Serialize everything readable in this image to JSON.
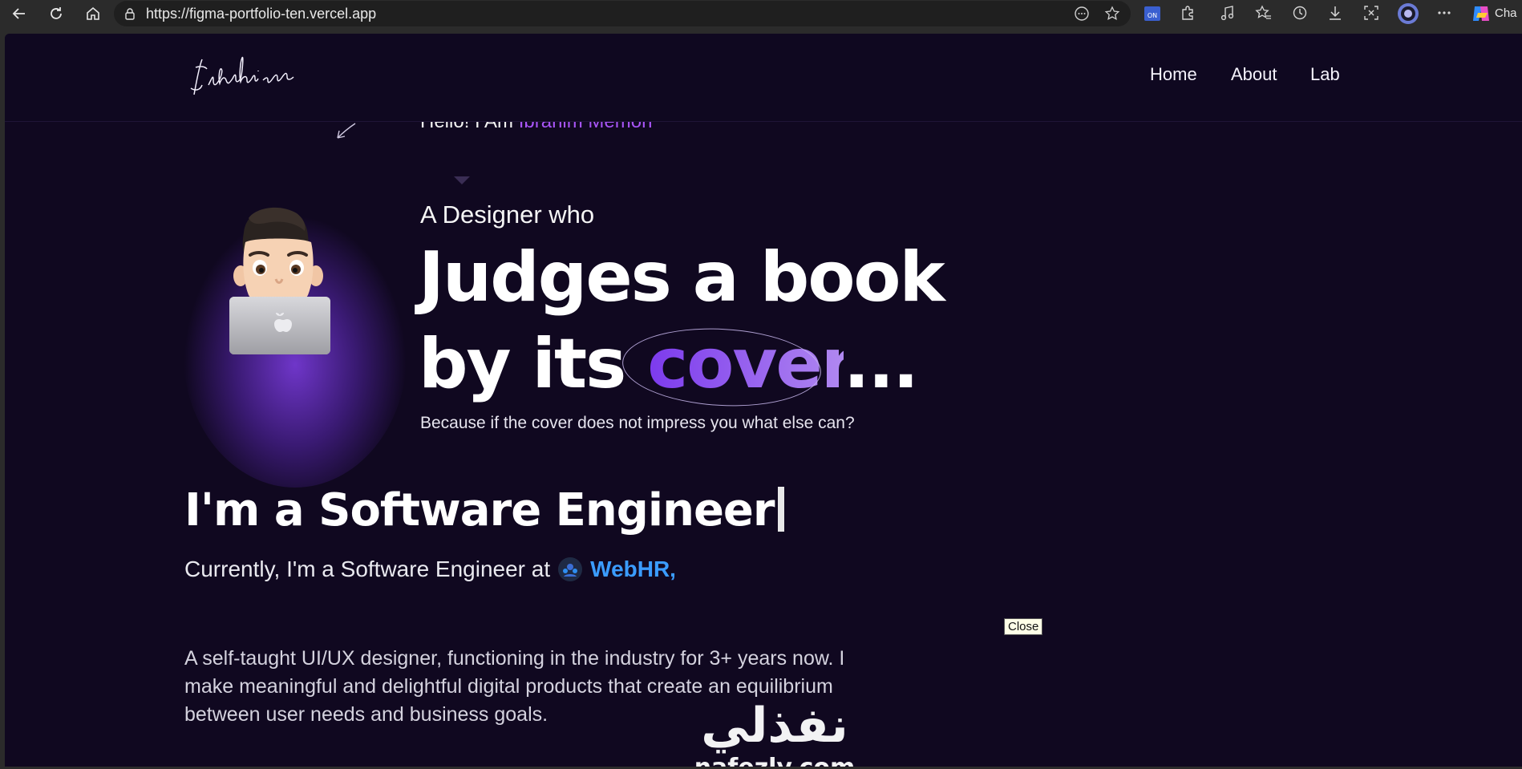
{
  "browser": {
    "url": "https://figma-portfolio-ten.vercel.app",
    "profile_label": "Cha",
    "icons": [
      "back-icon",
      "refresh-icon",
      "home-icon",
      "lock-icon",
      "reader-mode-icon",
      "favorite-star-icon",
      "extension-on-icon",
      "extensions-puzzle-icon",
      "media-icon",
      "favorites-icon",
      "history-icon",
      "download-icon",
      "screenshot-icon",
      "profile-icon",
      "more-icon",
      "copilot-icon"
    ]
  },
  "site": {
    "logo_text": "Ibrahim",
    "nav": [
      {
        "label": "Home"
      },
      {
        "label": "About"
      },
      {
        "label": "Lab"
      }
    ]
  },
  "hero": {
    "hello_prefix": "Hello! I Am ",
    "hello_name": "Ibrahim Memon",
    "eyebrow": "A Designer who",
    "line1": "Judges a book",
    "line2_prefix": "by its ",
    "line2_highlight": "cover",
    "line2_suffix": "...",
    "tagline": "Because if the cover does not impress you what else can?"
  },
  "about": {
    "role": "I'm a Software Engineer",
    "current_prefix": "Currently, I'm a Software Engineer at",
    "company": "WebHR,",
    "bio": "A self-taught UI/UX designer, functioning in the industry for 3+ years now. I make meaningful and delightful digital products that create an equilibrium between user needs and business goals."
  },
  "tooltip": {
    "close_label": "Close"
  },
  "watermark": {
    "arabic": "نفذلي",
    "latin": "nafezly.com"
  },
  "colors": {
    "page_bg": "#100820",
    "accent_purple": "#a855f7",
    "company_blue": "#3b9cff"
  }
}
